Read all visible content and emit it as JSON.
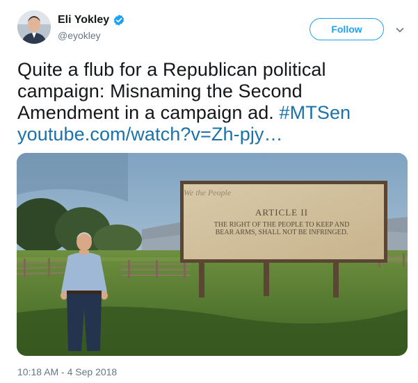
{
  "author": {
    "display_name": "Eli Yokley",
    "handle": "@eyokley",
    "verified": true
  },
  "header": {
    "follow_label": "Follow",
    "menu_icon": "chevron-down-icon"
  },
  "tweet": {
    "text": "Quite a flub for a Republican political campaign: Misnaming the Second Amendment in a campaign ad.",
    "hashtag": "#MTSen",
    "link": "youtube.com/watch?v=Zh-pjy…"
  },
  "media": {
    "billboard_script": "We the People",
    "billboard_heading": "ARTICLE II",
    "billboard_line1": "THE RIGHT OF THE PEOPLE TO KEEP AND",
    "billboard_line2": "BEAR ARMS, SHALL NOT BE INFRINGED."
  },
  "timestamp": "10:18 AM - 4 Sep 2018",
  "colors": {
    "accent": "#1da1f2",
    "link": "#1b72a8",
    "secondary_text": "#657786"
  }
}
